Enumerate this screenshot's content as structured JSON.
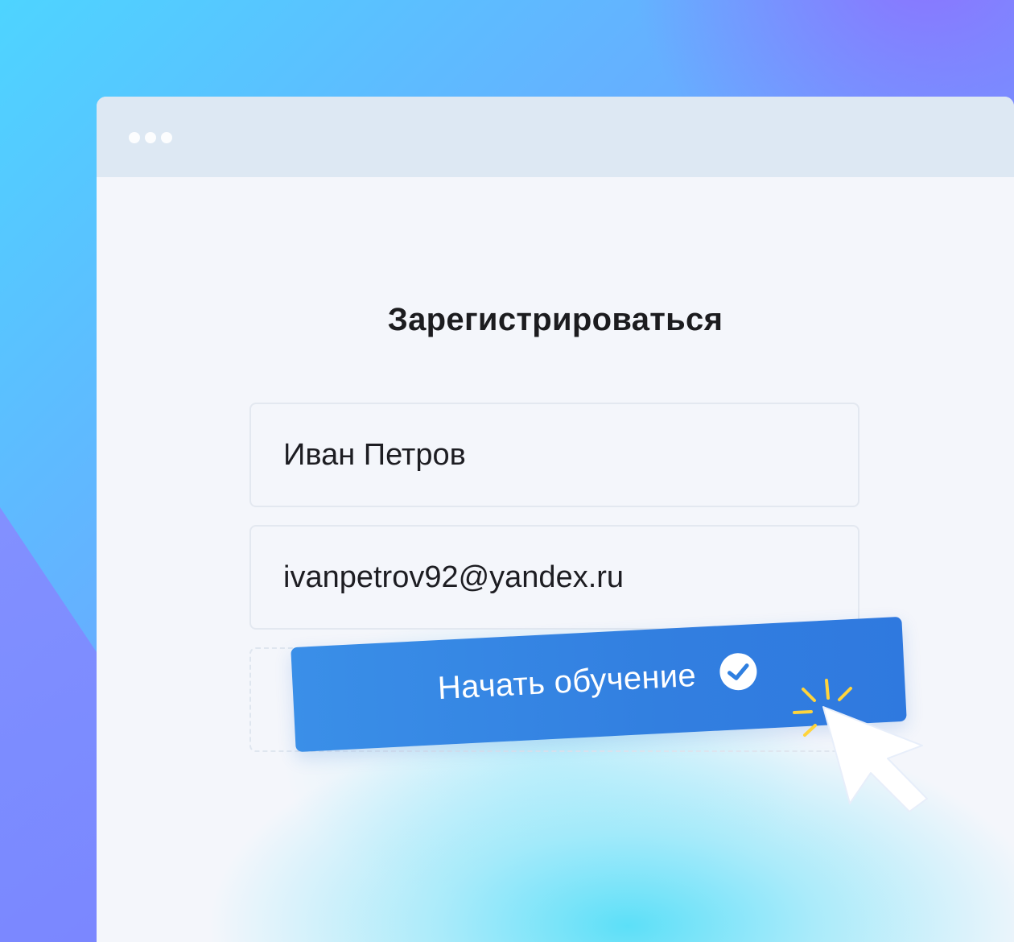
{
  "form": {
    "title": "Зарегистрироваться",
    "name_value": "Иван Петров",
    "email_value": "ivanpetrov92@yandex.ru",
    "submit_label": "Начать обучение"
  },
  "icons": {
    "window_controls": "three-dots-icon",
    "submit_status": "check-circle-icon",
    "click_effect": "sparkle-icon",
    "pointer": "mouse-cursor-icon"
  },
  "colors": {
    "button": "#3282e2",
    "sparkle": "#ffd43b",
    "window_background": "#f4f6fb",
    "titlebar": "#dde8f3"
  }
}
